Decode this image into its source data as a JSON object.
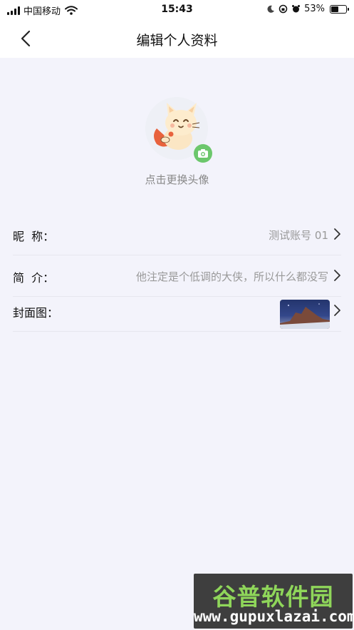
{
  "status_bar": {
    "carrier": "中国移动",
    "time": "15:43",
    "battery_percent_label": "53%",
    "battery_level": 0.53
  },
  "nav": {
    "title": "编辑个人资料"
  },
  "avatar": {
    "hint": "点击更换头像"
  },
  "profile_rows": [
    {
      "label": "昵  称：",
      "value": "测试账号 01"
    },
    {
      "label": "简  介：",
      "value": "他注定是个低调的大侠，所以什么都没写"
    },
    {
      "label": "封面图：",
      "value": ""
    }
  ],
  "watermark": {
    "title": "谷普软件园",
    "url": "www.gupuxlazai.com"
  },
  "colors": {
    "accent_green": "#6cc76c",
    "page_background": "#f3f3fb"
  }
}
